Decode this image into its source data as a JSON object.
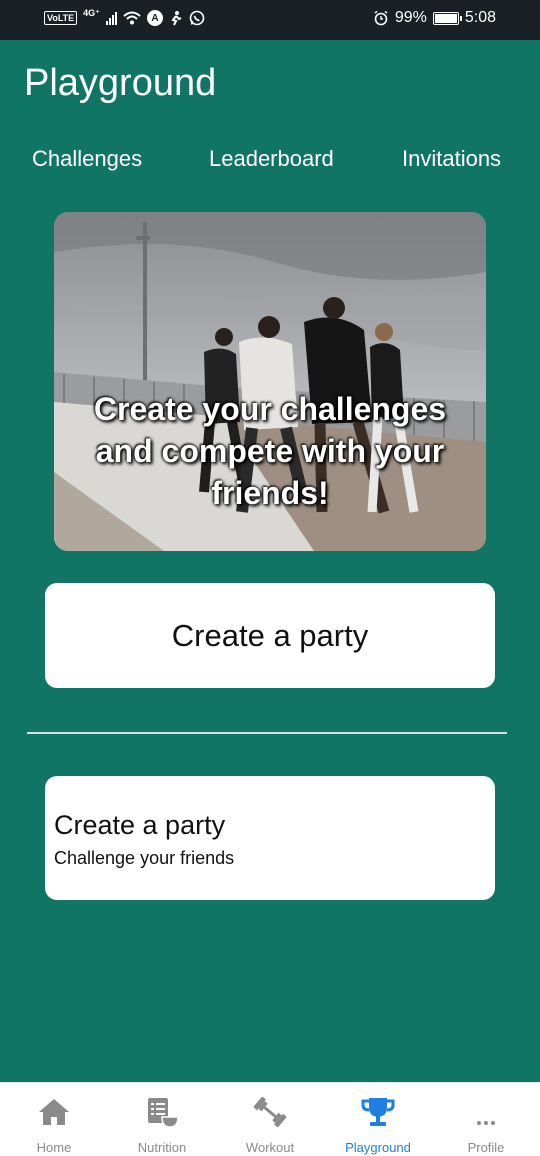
{
  "status_bar": {
    "left_badges": [
      "VoLTE",
      "4G⁺"
    ],
    "battery": "99%",
    "time": "5:08"
  },
  "header": {
    "title": "Playground"
  },
  "tabs": [
    {
      "label": "Challenges"
    },
    {
      "label": "Leaderboard"
    },
    {
      "label": "Invitations"
    }
  ],
  "hero": {
    "caption_line1": "Create your challenges",
    "caption_line2": "and compete with your",
    "caption_line3": "friends!"
  },
  "create_party_button": {
    "label": "Create a party"
  },
  "party_card": {
    "title": "Create a party",
    "subtitle": "Challenge your friends"
  },
  "bottom_nav": {
    "items": [
      {
        "label": "Home",
        "icon": "home-icon"
      },
      {
        "label": "Nutrition",
        "icon": "nutrition-icon"
      },
      {
        "label": "Workout",
        "icon": "dumbbell-icon"
      },
      {
        "label": "Playground",
        "icon": "trophy-icon",
        "active": true
      },
      {
        "label": "Profile",
        "icon": "more-icon"
      }
    ]
  },
  "colors": {
    "background": "#117565",
    "active_nav": "#1f7fe0",
    "status_bar": "#1b1f26"
  }
}
